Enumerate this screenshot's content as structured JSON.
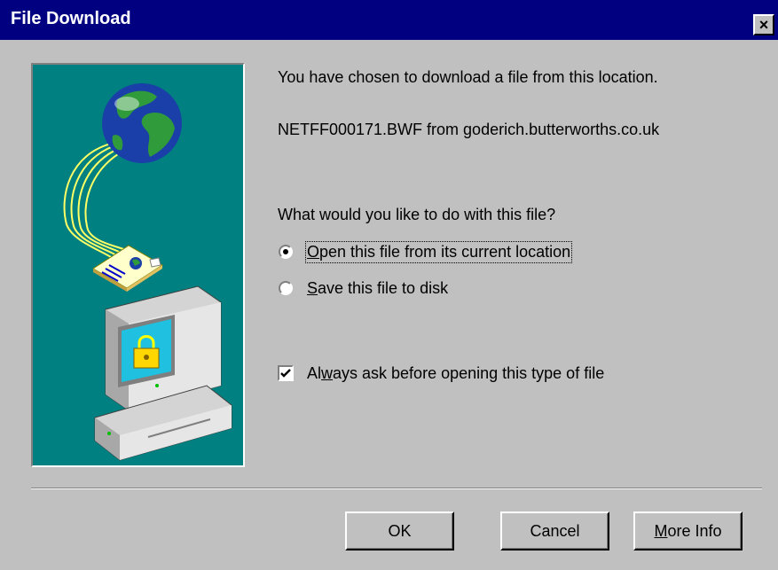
{
  "window": {
    "title": "File Download",
    "close_label": "×"
  },
  "message": {
    "line1": "You have chosen to download a file from this location.",
    "file_info": "NETFF000171.BWF from goderich.butterworths.co.uk",
    "question": "What would you like to do with this file?"
  },
  "options": {
    "open_mnemonic": "O",
    "open_rest": "pen this file from its current location",
    "open_selected": true,
    "save_mnemonic": "S",
    "save_rest": "ave this file to disk",
    "save_selected": false
  },
  "always_ask": {
    "prefix": "Al",
    "mnemonic": "w",
    "rest": "ays ask before opening this type of file",
    "checked": true
  },
  "buttons": {
    "ok": "OK",
    "cancel": "Cancel",
    "more_info_mnemonic": "M",
    "more_info_rest": "ore Info"
  },
  "icons": [
    "globe-icon",
    "document-icon",
    "computer-icon",
    "lock-icon",
    "close-icon"
  ]
}
